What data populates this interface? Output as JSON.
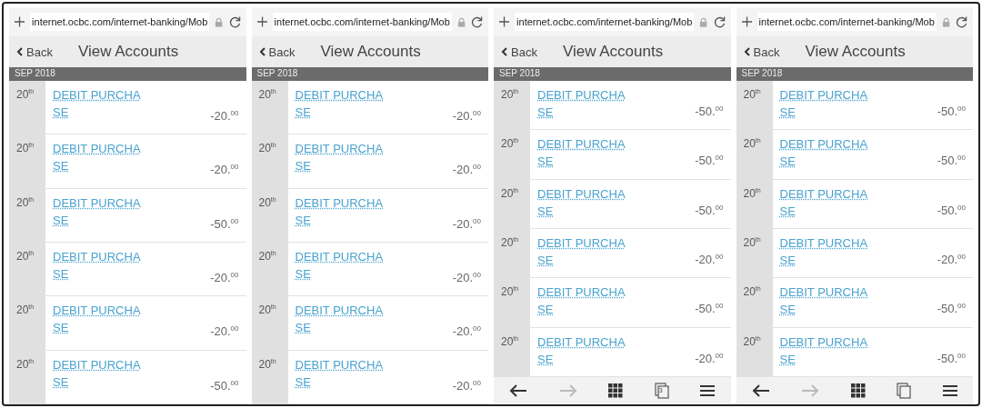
{
  "screens": [
    {
      "url": "internet.ocbc.com/internet-banking/Mob",
      "back": "Back",
      "title": "View Accounts",
      "month": "SEP 2018",
      "transactions": [
        {
          "day": "20$^{th}$",
          "desc_lines": [
            "DEBIT PURCHA",
            "SE"
          ],
          "amount": "-20.$^{00}$"
        },
        {
          "day": "20$^{th}$",
          "desc_lines": [
            "DEBIT PURCHA",
            "SE"
          ],
          "amount": "-20.$^{00}$"
        },
        {
          "day": "20$^{th}$",
          "desc_lines": [
            "DEBIT PURCHA",
            "SE"
          ],
          "amount": "-50.$^{00}$"
        },
        {
          "day": "20$^{th}$",
          "desc_lines": [
            "DEBIT PURCHA",
            "SE"
          ],
          "amount": "-20.$^{00}$"
        },
        {
          "day": "20$^{th}$",
          "desc_lines": [
            "DEBIT PURCHA",
            "SE"
          ],
          "amount": "-20.$^{00}$"
        },
        {
          "day": "20$^{th}$",
          "desc_lines": [
            "DEBIT PURCHA",
            "SE"
          ],
          "amount": "-50.$^{00}$"
        }
      ]
    },
    {
      "url": "internet.ocbc.com/internet-banking/Mob",
      "back": "Back",
      "title": "View Accounts",
      "month": "SEP 2018",
      "transactions": [
        {
          "day": "20$^{th}$",
          "desc_lines": [
            "DEBIT PURCHA",
            "SE"
          ],
          "amount": "-20.$^{00}$"
        },
        {
          "day": "20$^{th}$",
          "desc_lines": [
            "DEBIT PURCHA",
            "SE"
          ],
          "amount": "-20.$^{00}$"
        },
        {
          "day": "20$^{th}$",
          "desc_lines": [
            "DEBIT PURCHA",
            "SE"
          ],
          "amount": "-20.$^{00}$"
        },
        {
          "day": "20$^{th}$",
          "desc_lines": [
            "DEBIT PURCHA",
            "SE"
          ],
          "amount": "-20.$^{00}$"
        },
        {
          "day": "20$^{th}$",
          "desc_lines": [
            "DEBIT PURCHA",
            "SE"
          ],
          "amount": "-20.$^{00}$"
        },
        {
          "day": "20$^{th}$",
          "desc_lines": [
            "DEBIT PURCHA",
            "SE"
          ],
          "amount": "-20.$^{00}$"
        }
      ]
    },
    {
      "url": "internet.ocbc.com/internet-banking/Mob",
      "back": "Back",
      "title": "View Accounts",
      "month": "SEP 2018",
      "transactions": [
        {
          "day": "20$^{th}$",
          "desc_lines": [
            "DEBIT PURCHA",
            "SE"
          ],
          "amount": "-50.$^{00}$"
        },
        {
          "day": "20$^{th}$",
          "desc_lines": [
            "DEBIT PURCHA",
            "SE"
          ],
          "amount": "-50.$^{00}$"
        },
        {
          "day": "20$^{th}$",
          "desc_lines": [
            "DEBIT PURCHA",
            "SE"
          ],
          "amount": "-50.$^{00}$"
        },
        {
          "day": "20$^{th}$",
          "desc_lines": [
            "DEBIT PURCHA",
            "SE"
          ],
          "amount": "-20.$^{00}$"
        },
        {
          "day": "20$^{th}$",
          "desc_lines": [
            "DEBIT PURCHA",
            "SE"
          ],
          "amount": "-50.$^{00}$"
        },
        {
          "day": "20$^{th}$",
          "desc_lines": [
            "DEBIT PURCHA",
            "SE"
          ],
          "amount": "-20.$^{00}$"
        }
      ],
      "toolbar": {
        "forward_disabled": true,
        "tab_count": "3"
      }
    },
    {
      "url": "internet.ocbc.com/internet-banking/Mob",
      "back": "Back",
      "title": "View Accounts",
      "month": "SEP 2018",
      "transactions": [
        {
          "day": "20$^{th}$",
          "desc_lines": [
            "DEBIT PURCHA",
            "SE"
          ],
          "amount": "-50.$^{00}$"
        },
        {
          "day": "20$^{th}$",
          "desc_lines": [
            "DEBIT PURCHA",
            "SE"
          ],
          "amount": "-50.$^{00}$"
        },
        {
          "day": "20$^{th}$",
          "desc_lines": [
            "DEBIT PURCHA",
            "SE"
          ],
          "amount": "-50.$^{00}$"
        },
        {
          "day": "20$^{th}$",
          "desc_lines": [
            "DEBIT PURCHA",
            "SE"
          ],
          "amount": "-20.$^{00}$"
        },
        {
          "day": "20$^{th}$",
          "desc_lines": [
            "DEBIT PURCHA",
            "SE"
          ],
          "amount": "-50.$^{00}$"
        },
        {
          "day": "20$^{th}$",
          "desc_lines": [
            "DEBIT PURCHA",
            "SE"
          ],
          "amount": "-50.$^{00}$"
        }
      ],
      "toolbar": {
        "forward_disabled": true
      }
    }
  ]
}
